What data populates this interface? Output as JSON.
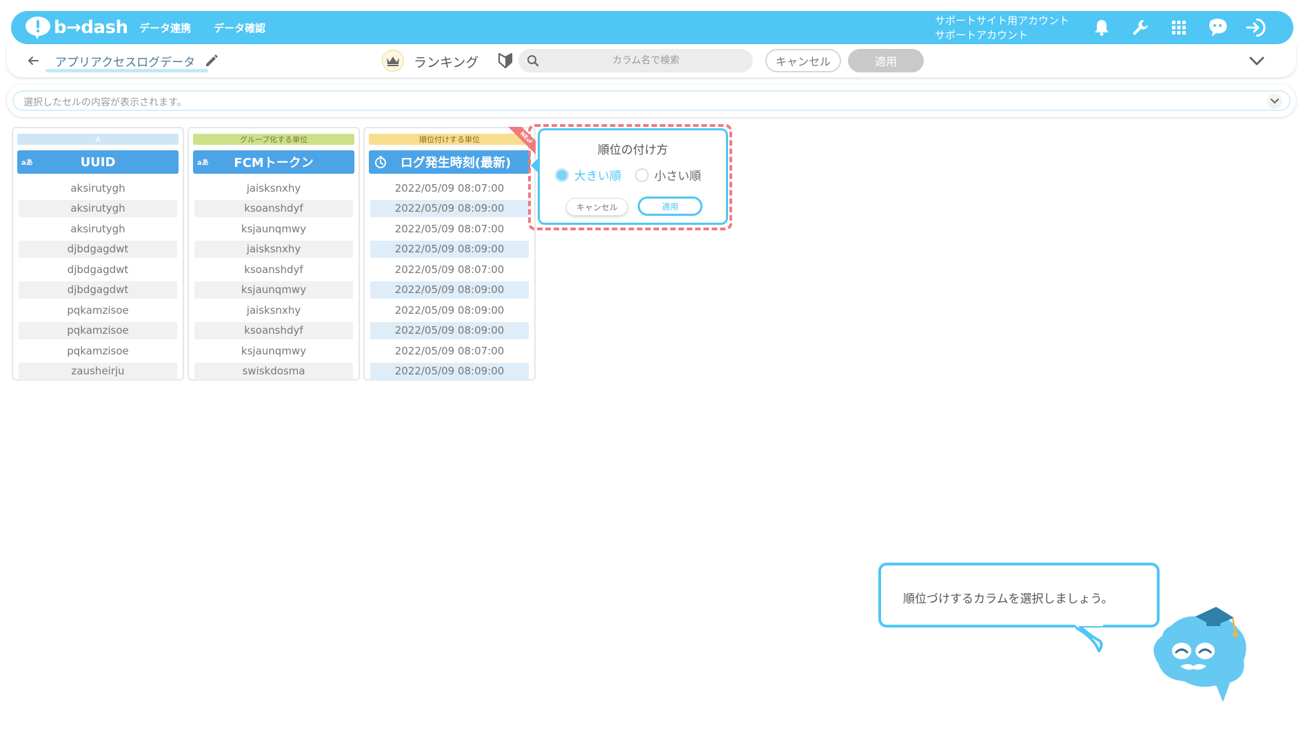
{
  "app": {
    "logo_text": "b→dash",
    "nav": [
      "データ連携",
      "データ確認"
    ],
    "account_line1": "サポートサイト用アカウント",
    "account_line2": "サポートアカウント",
    "top_icons": [
      "bell-icon",
      "wrench-icon",
      "grid-icon",
      "mascot-chat-icon",
      "logout-icon"
    ]
  },
  "toolbar": {
    "title": "アプリアクセスログデータ",
    "mode_label": "ランキング",
    "search_placeholder": "カラム名で検索",
    "cancel_label": "キャンセル",
    "apply_label": "適用"
  },
  "cellbar": {
    "placeholder": "選択したセルの内容が表示されます。"
  },
  "columns": [
    {
      "tag": "A",
      "tag_color": "#cfe6f5",
      "type_badge": "aあ",
      "header": "UUID",
      "rows": [
        "aksirutygh",
        "aksirutygh",
        "aksirutygh",
        "djbdgagdwt",
        "djbdgagdwt",
        "djbdgagdwt",
        "pqkamzisoe",
        "pqkamzisoe",
        "pqkamzisoe",
        "zausheirju"
      ]
    },
    {
      "tag": "グループ化する単位",
      "tag_color": "#cfe08a",
      "type_badge": "aあ",
      "header": "FCMトークン",
      "rows": [
        "jaisksnxhy",
        "ksoanshdyf",
        "ksjaunqmwy",
        "jaisksnxhy",
        "ksoanshdyf",
        "ksjaunqmwy",
        "jaisksnxhy",
        "ksoanshdyf",
        "ksjaunqmwy",
        "swiskdosma"
      ]
    },
    {
      "tag": "順位付けする単位",
      "tag_color": "#f7dd8e",
      "type_badge": "clock-icon",
      "header": "ログ発生時刻(最新)",
      "badge": "NEW",
      "rows": [
        "2022/05/09 08:07:00",
        "2022/05/09 08:09:00",
        "2022/05/09 08:07:00",
        "2022/05/09 08:09:00",
        "2022/05/09 08:07:00",
        "2022/05/09 08:09:00",
        "2022/05/09 08:09:00",
        "2022/05/09 08:09:00",
        "2022/05/09 08:07:00",
        "2022/05/09 08:09:00"
      ]
    }
  ],
  "popover": {
    "title": "順位の付け方",
    "option_desc": "大きい順",
    "option_asc": "小さい順",
    "selected": "desc",
    "cancel_label": "キャンセル",
    "apply_label": "適用"
  },
  "tooltip": {
    "text": "順位づけするカラムを選択しましょう。"
  },
  "colors": {
    "brand": "#4fc6f4",
    "header_blue": "#4ca3e6",
    "highlight_dash": "#f07a80"
  }
}
